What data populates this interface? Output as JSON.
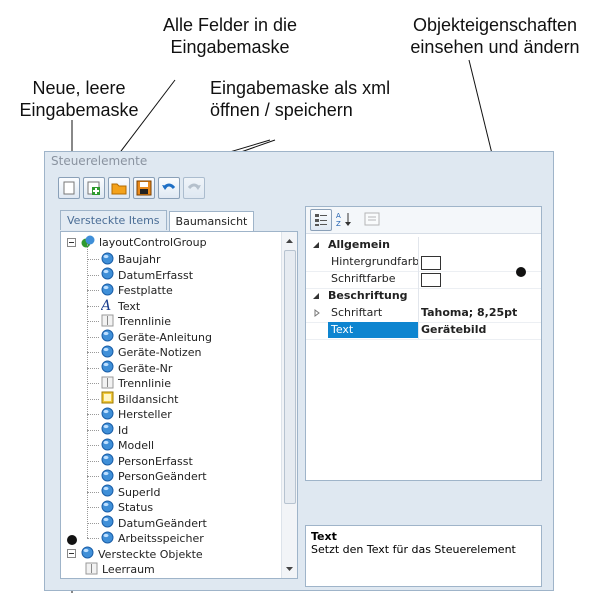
{
  "annotations": {
    "fields_line1": "Alle Felder in die",
    "fields_line2": "Eingabemaske",
    "props_line1": "Objekteigenschaften",
    "props_line2": "einsehen und ändern",
    "new_line1": "Neue, leere",
    "new_line2": "Eingabemaske",
    "xml_line1": "Eingabemaske als xml",
    "xml_line2": "öffnen / speichern"
  },
  "window": {
    "title": "Steuerelemente"
  },
  "toolbar": [
    {
      "name": "new-icon",
      "enabled": true
    },
    {
      "name": "add-all-fields-icon",
      "enabled": true
    },
    {
      "name": "open-folder-icon",
      "enabled": true
    },
    {
      "name": "save-disk-icon",
      "enabled": true
    },
    {
      "name": "undo-icon",
      "enabled": true
    },
    {
      "name": "redo-icon",
      "enabled": false
    }
  ],
  "tabs": [
    {
      "label": "Versteckte Items",
      "active": false
    },
    {
      "label": "Baumansicht",
      "active": true
    }
  ],
  "tree": {
    "root": "layoutControlGroup",
    "items": [
      {
        "label": "Baujahr",
        "icon": "field"
      },
      {
        "label": "DatumErfasst",
        "icon": "field"
      },
      {
        "label": "Festplatte",
        "icon": "field"
      },
      {
        "label": "Text",
        "icon": "text"
      },
      {
        "label": "Trennlinie",
        "icon": "separator"
      },
      {
        "label": "Geräte-Anleitung",
        "icon": "field"
      },
      {
        "label": "Geräte-Notizen",
        "icon": "field"
      },
      {
        "label": "Geräte-Nr",
        "icon": "field"
      },
      {
        "label": "Trennlinie",
        "icon": "separator"
      },
      {
        "label": "Bildansicht",
        "icon": "image"
      },
      {
        "label": "Hersteller",
        "icon": "field"
      },
      {
        "label": "Id",
        "icon": "field"
      },
      {
        "label": "Modell",
        "icon": "field"
      },
      {
        "label": "PersonErfasst",
        "icon": "field"
      },
      {
        "label": "PersonGeändert",
        "icon": "field"
      },
      {
        "label": "SuperId",
        "icon": "field"
      },
      {
        "label": "Status",
        "icon": "field"
      },
      {
        "label": "DatumGeändert",
        "icon": "field"
      },
      {
        "label": "Arbeitsspeicher",
        "icon": "field"
      }
    ],
    "hidden_group": "Versteckte Objekte",
    "hidden_first": "Leerraum"
  },
  "properties": {
    "categories": [
      {
        "label": "Allgemein",
        "rows": [
          {
            "name": "Hintergrundfarb",
            "value": ""
          },
          {
            "name": "Schriftfarbe",
            "value": ""
          }
        ]
      },
      {
        "label": "Beschriftung",
        "rows": [
          {
            "name": "Schriftart",
            "value": "Tahoma; 8,25pt"
          },
          {
            "name": "Text",
            "value": "Gerätebild"
          }
        ]
      }
    ]
  },
  "description": {
    "title": "Text",
    "body": "Setzt den Text für das Steuerelement"
  },
  "colors": {
    "accent": "#0b82d6",
    "selected": "#0e85d0",
    "border": "#9fb4c9"
  }
}
